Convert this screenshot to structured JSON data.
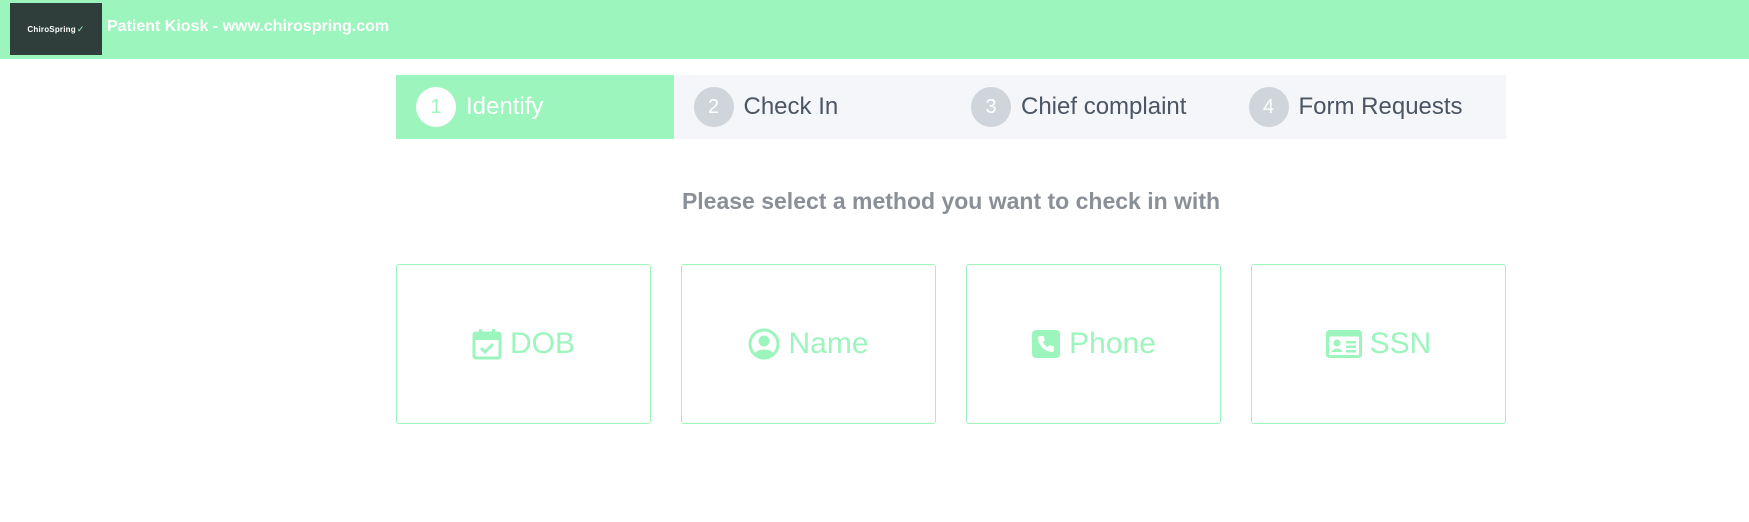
{
  "header": {
    "logo_text": "ChiroSpring",
    "title": "Patient Kiosk - www.chirospring.com"
  },
  "steps": [
    {
      "number": "1",
      "label": "Identify",
      "active": true
    },
    {
      "number": "2",
      "label": "Check In",
      "active": false
    },
    {
      "number": "3",
      "label": "Chief complaint",
      "active": false
    },
    {
      "number": "4",
      "label": "Form Requests",
      "active": false
    }
  ],
  "prompt": "Please select a method you want to check in with",
  "methods": [
    {
      "label": "DOB",
      "icon": "calendar-check-icon"
    },
    {
      "label": "Name",
      "icon": "user-circle-icon"
    },
    {
      "label": "Phone",
      "icon": "phone-square-icon"
    },
    {
      "label": "SSN",
      "icon": "id-card-icon"
    }
  ],
  "colors": {
    "accent": "#9cf5bd",
    "logo_bg": "#2f3e3a",
    "step_bar_bg": "#f4f6f9",
    "step_inactive_circle": "#cfd5da",
    "prompt_text": "#8a8f98"
  }
}
